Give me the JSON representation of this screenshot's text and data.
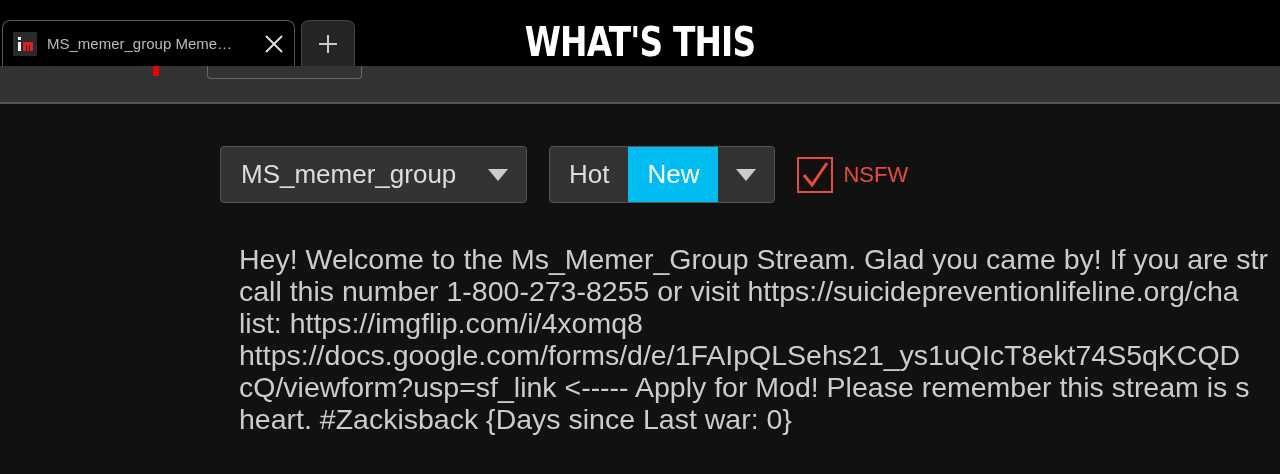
{
  "browser": {
    "tabs": [
      {
        "title": "MS_memer_group Meme…",
        "selected": true
      }
    ]
  },
  "caption": "WHAT'S THIS",
  "stream_select": {
    "value": "MS_memer_group"
  },
  "sort_tabs": [
    {
      "label": "Hot",
      "selected": false
    },
    {
      "label": "New",
      "selected": true
    }
  ],
  "nsfw": {
    "label": "NSFW",
    "checked": true
  },
  "description": [
    "Hey! Welcome to the Ms_Memer_Group Stream. Glad you came by! If you are str",
    "call this number 1-800-273-8255 or visit https://suicidepreventionlifeline.org/cha",
    "list: https://imgflip.com/i/4xomq8",
    "https://docs.google.com/forms/d/e/1FAIpQLSehs21_ys1uQIcT8ekt74S5qKCQD",
    "cQ/viewform?usp=sf_link <----- Apply for Mod! Please remember this stream is s",
    "heart. #Zackisback {Days since Last war: 0}"
  ]
}
